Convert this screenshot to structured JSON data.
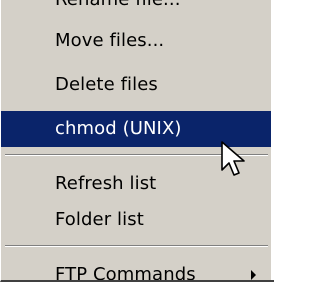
{
  "menu": {
    "items": [
      {
        "label": "Rename file..."
      },
      {
        "label": "Move files..."
      },
      {
        "label": "Delete files"
      },
      {
        "label": "chmod (UNIX)"
      },
      {
        "label": "Refresh list"
      },
      {
        "label": "Folder list"
      },
      {
        "label": "FTP Commands"
      }
    ],
    "selected_index": 3
  },
  "colors": {
    "menu_background": "#d4d0c8",
    "selection_background": "#0a246a",
    "selection_text": "#ffffff",
    "text": "#000000"
  },
  "icons": {
    "cursor": "arrow-cursor-icon",
    "submenu": "submenu-arrow-icon"
  }
}
